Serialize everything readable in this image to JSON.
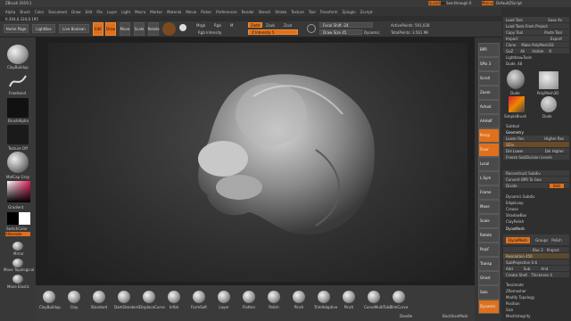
{
  "app": {
    "title": "ZBrush 2019.1"
  },
  "top_right": {
    "quicksave": "QuickSave",
    "seethrough": "See-through 0",
    "menus": "Menus",
    "default_script": "DefaultZScript"
  },
  "menus": [
    "Alpha",
    "Brush",
    "Color",
    "Document",
    "Draw",
    "Edit",
    "File",
    "Layer",
    "Light",
    "Macro",
    "Marker",
    "Material",
    "Movie",
    "Picker",
    "Preferences",
    "Render",
    "Stencil",
    "Stroke",
    "Texture",
    "Tool",
    "Transform",
    "Zplugin",
    "Zscript"
  ],
  "status": {
    "coords": "0.304,0.324,0.195"
  },
  "top_shelf": {
    "home_page": "Home Page",
    "lightbox": "LightBox",
    "live_boolean": "Live Boolean",
    "edit": "Edit",
    "draw": "Draw",
    "move": "Move",
    "scale": "Scale",
    "rotate": "Rotate",
    "mrgb": "Mrgb",
    "rgb": "Rgb",
    "m": "M",
    "zadd": "Zadd",
    "zsub": "Zsub",
    "zcut": "Zcut",
    "rgb_intensity": "Rgb Intensity",
    "z_intensity": "Z Intensity 5",
    "focal_shift": "Focal Shift -24",
    "draw_size": "Draw Size 45",
    "dynamic": "Dynamic",
    "active_points": "ActivePoints: 591,028",
    "total_points": "TotalPoints: 3.561 Mil"
  },
  "left_tray": {
    "clay_buildup": "ClayBuildup",
    "freehand": "FreeHand",
    "brush_alpha": "BrushAlpha",
    "texture_off": "Texture Off",
    "matcap_gray": "MatCap Gray",
    "gradient": "Gradient",
    "switch_color": "SwitchColor",
    "alternate": "Alternate",
    "mirror": "Mirror",
    "move_topological": "Move Topological",
    "move_elastic": "Move Elastic"
  },
  "right_shelf": [
    "BPR",
    "SPix 3",
    "Scroll",
    "Zoom",
    "Actual",
    "AAHalf",
    "Persp",
    "Floor",
    "Local",
    "L.Sym",
    "Frame",
    "Move",
    "Scale",
    "Rotate",
    "PolyF",
    "Transp",
    "Ghost",
    "Solo",
    "Dynamic"
  ],
  "right_tray": {
    "load_tool": "Load Tool",
    "save_as": "Save As",
    "load_from_project": "Load Tools From Project",
    "copy_tool": "Copy Tool",
    "paste_tool": "Paste Tool",
    "import": "Import",
    "export": "Export",
    "clone": "Clone",
    "make_polymesh": "Make PolyMesh3D",
    "goz": "GoZ",
    "all": "All",
    "visible": "Visible",
    "r": "R",
    "lightbox_tools": "Lightbox▸Tools",
    "dude": "Dude. 48",
    "tools": [
      "Dude",
      "PolyMesh3D",
      "SimpleBrush",
      "Dude"
    ],
    "subtool": "Subtool",
    "geometry": "Geometry",
    "lower_res": "Lower Res",
    "higher_res": "Higher Res",
    "sdiv": "SDiv",
    "del_lower": "Del Lower",
    "del_higher": "Del Higher",
    "freeze": "Freeze SubDivision Levels",
    "reconstruct": "Reconstruct Subdiv",
    "convert_bpr": "Convert BPR To Geo",
    "divide": "Divide",
    "smt": "Smt",
    "dynamic_subdiv": "Dynamic Subdiv",
    "edgeloop": "EdgeLoop",
    "crease": "Crease",
    "shadowbox": "ShadowBox",
    "claypolish": "ClayPolish",
    "dynamesh_header": "DynaMesh",
    "dynamesh": "DynaMesh",
    "groups": "Groups",
    "polish": "Polish",
    "blur": "Blur 2",
    "project": "Project",
    "resolution": "Resolution 456",
    "subprojection": "SubProjection 0.6",
    "add": "Add",
    "sub": "Sub",
    "and": "And",
    "create_shell": "Create Shell",
    "thickness": "Thickness 4",
    "tessimate": "Tessimate",
    "zremesher": "ZRemesher",
    "modify_topology": "Modify Topology",
    "position": "Position",
    "size": "Size",
    "meshintegrity": "MeshIntegrity"
  },
  "bottom_brushes": [
    "ClayBuildup",
    "Clay",
    "Standard",
    "DamStandard",
    "DisplaceCurve",
    "Inflat",
    "FormSoft",
    "Layer",
    "Flatten",
    "Polish",
    "Pinch",
    "TrimAdaptive",
    "Pinch",
    "CurveMultiTube",
    "TrimCurve"
  ],
  "bottom_status": {
    "doodle": "Doodle",
    "backface": "BackfaceMask"
  }
}
